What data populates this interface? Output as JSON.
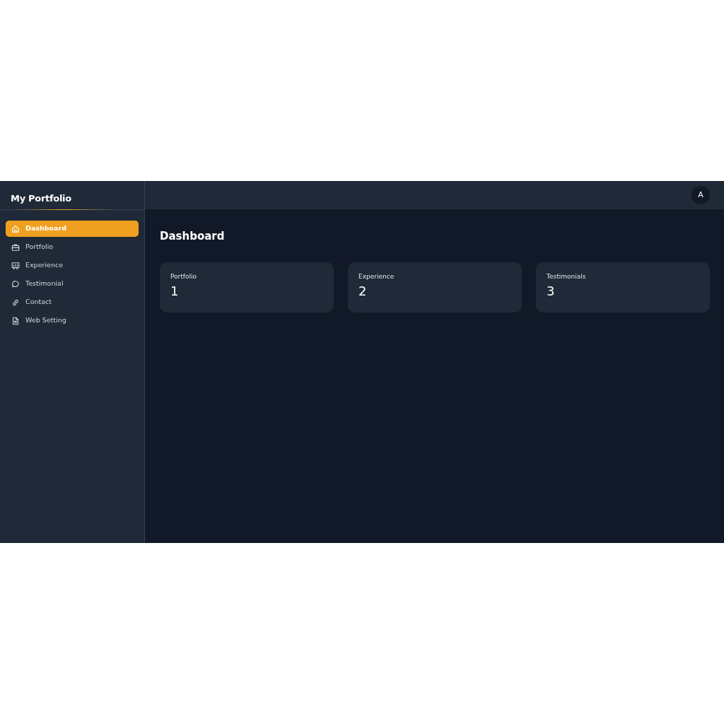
{
  "sidebar": {
    "brand": "My Portfolio",
    "items": [
      {
        "label": "Dashboard",
        "selected": true
      },
      {
        "label": "Portfolio",
        "selected": false
      },
      {
        "label": "Experience",
        "selected": false
      },
      {
        "label": "Testimonial",
        "selected": false
      },
      {
        "label": "Contact",
        "selected": false
      },
      {
        "label": "Web Setting",
        "selected": false
      }
    ]
  },
  "topbar": {
    "avatar": "A"
  },
  "page": {
    "title": "Dashboard",
    "stats": [
      {
        "label": "Portfolio",
        "value": "1"
      },
      {
        "label": "Experience",
        "value": "2"
      },
      {
        "label": "Testimonials",
        "value": "3"
      }
    ]
  }
}
